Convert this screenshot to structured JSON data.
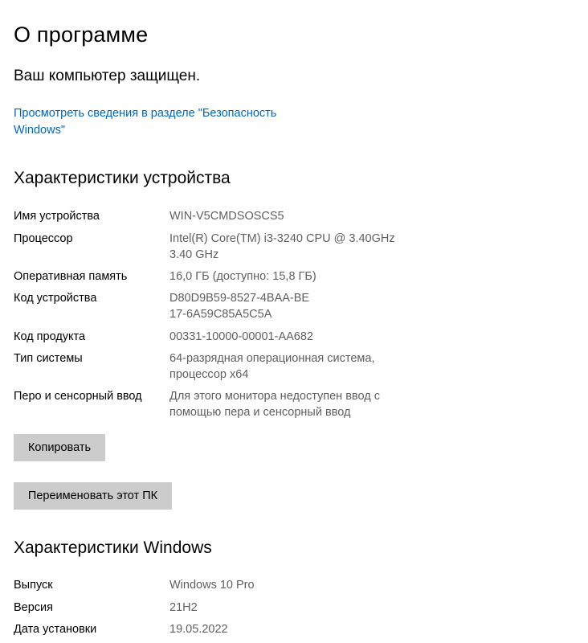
{
  "header": {
    "title": "О программе",
    "status": "Ваш компьютер защищен.",
    "security_link": "Просмотреть сведения в разделе \"Безопасность Windows\""
  },
  "device": {
    "heading": "Характеристики устройства",
    "specs": [
      {
        "label": "Имя устройства",
        "value": "WIN-V5CMDSOSCS5"
      },
      {
        "label": "Процессор",
        "value": "Intel(R) Core(TM) i3-3240 CPU @ 3.40GHz 3.40 GHz"
      },
      {
        "label": "Оперативная память",
        "value": "16,0 ГБ (доступно: 15,8 ГБ)"
      },
      {
        "label": "Код устройства",
        "value": "D80D9B59-8527-4BAA-BE17-6A59C85A5C5A"
      },
      {
        "label": "Код продукта",
        "value": "00331-10000-00001-AA682"
      },
      {
        "label": "Тип системы",
        "value": "64-разрядная операционная система, процессор x64"
      },
      {
        "label": "Перо и сенсорный ввод",
        "value": "Для этого монитора недоступен ввод с помощью пера и сенсорный ввод"
      }
    ],
    "copy_button": "Копировать",
    "rename_button": "Переименовать этот ПК"
  },
  "windows": {
    "heading": "Характеристики Windows",
    "specs": [
      {
        "label": "Выпуск",
        "value": "Windows 10 Pro"
      },
      {
        "label": "Версия",
        "value": "21H2"
      },
      {
        "label": "Дата установки",
        "value": "19.05.2022"
      }
    ]
  },
  "colors": {
    "link": "#0067b8",
    "value_text": "#5f5f5f",
    "button_bg": "#cccccc"
  }
}
